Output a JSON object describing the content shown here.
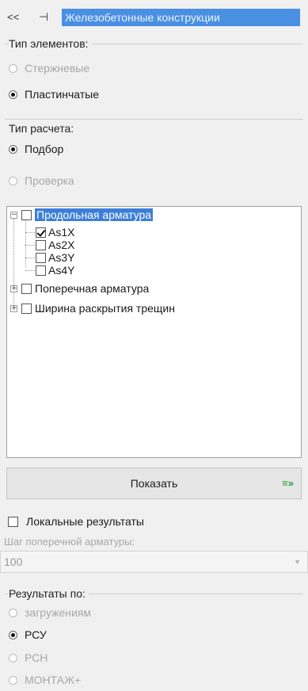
{
  "header": {
    "collapse_label": "<<",
    "pin_label": "⊣",
    "title": "Железобетонные конструкции"
  },
  "element_type": {
    "label": "Тип элементов:",
    "options": [
      {
        "label": "Стержневые",
        "checked": false,
        "disabled": true
      },
      {
        "label": "Пластинчатые",
        "checked": true,
        "disabled": false
      }
    ]
  },
  "calc_type": {
    "label": "Тип расчета:",
    "options": [
      {
        "label": "Подбор",
        "checked": true,
        "disabled": false
      },
      {
        "label": "Проверка",
        "checked": false,
        "disabled": true
      }
    ]
  },
  "tree": {
    "longitudinal": {
      "label": "Продольная арматура",
      "expanded": true,
      "checked": false,
      "children": [
        {
          "label": "As1X",
          "checked": true
        },
        {
          "label": "As2X",
          "checked": false
        },
        {
          "label": "As3Y",
          "checked": false
        },
        {
          "label": "As4Y",
          "checked": false
        }
      ]
    },
    "transverse": {
      "label": "Поперечная арматура",
      "expanded": false,
      "checked": false
    },
    "crack_width": {
      "label": "Ширина раскрытия трещин",
      "expanded": false,
      "checked": false
    }
  },
  "show_button": {
    "label": "Показать",
    "arrow": "≡»"
  },
  "local_results": {
    "label": "Локальные результаты",
    "checked": false
  },
  "step": {
    "label": "Шаг поперечной арматуры:",
    "value": "100",
    "arrow": "▼"
  },
  "results_by": {
    "label": "Результаты по:",
    "options": [
      {
        "label": "загружениям",
        "checked": false,
        "disabled": true
      },
      {
        "label": "РСУ",
        "checked": true,
        "disabled": false
      },
      {
        "label": "РСН",
        "checked": false,
        "disabled": true
      },
      {
        "label": "МОНТАЖ+",
        "checked": false,
        "disabled": true
      }
    ]
  },
  "colors": {
    "accent": "#4a90e2",
    "selection": "#3c7fd9",
    "background": "#f0f0f0"
  }
}
